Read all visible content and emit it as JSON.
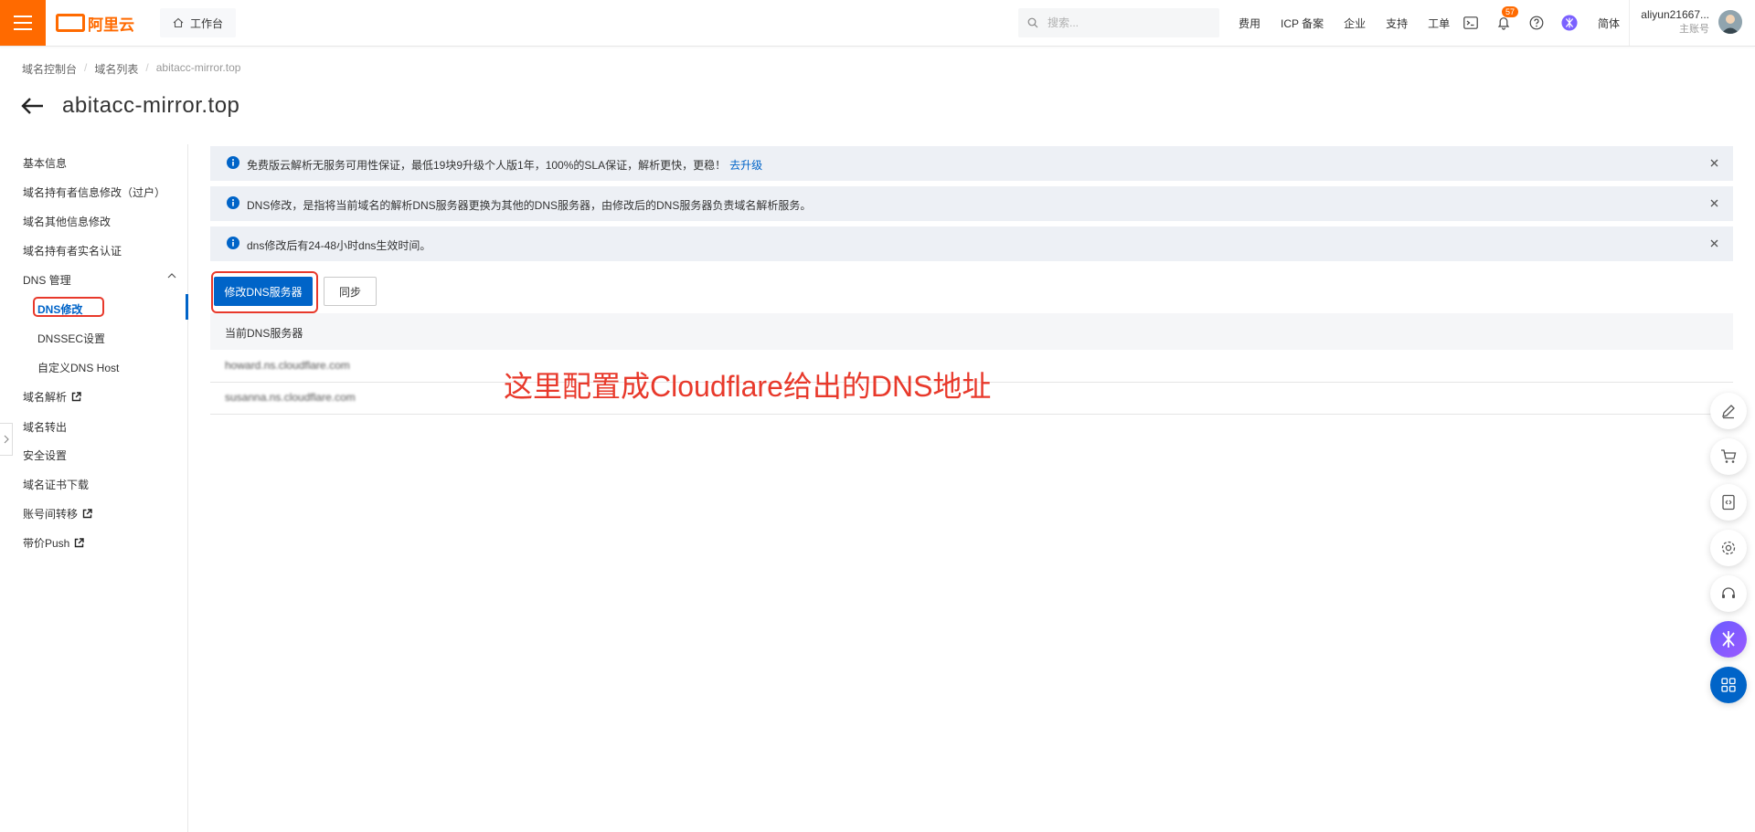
{
  "topbar": {
    "brand": "阿里云",
    "workbench_label": "工作台",
    "search_placeholder": "搜索...",
    "links": [
      "费用",
      "ICP 备案",
      "企业",
      "支持",
      "工单"
    ],
    "notification_count": "57",
    "language": "简体",
    "account_name": "aliyun21667...",
    "account_role": "主账号",
    "accent_color": "#ff6a00"
  },
  "breadcrumb": {
    "items": [
      "域名控制台",
      "域名列表"
    ],
    "current": "abitacc-mirror.top"
  },
  "page": {
    "title": "abitacc-mirror.top"
  },
  "sidebar": {
    "items": [
      {
        "label": "基本信息"
      },
      {
        "label": "域名持有者信息修改（过户）"
      },
      {
        "label": "域名其他信息修改"
      },
      {
        "label": "域名持有者实名认证"
      },
      {
        "label": "DNS 管理"
      },
      {
        "label": "DNS修改"
      },
      {
        "label": "DNSSEC设置"
      },
      {
        "label": "自定义DNS Host"
      },
      {
        "label": "域名解析"
      },
      {
        "label": "域名转出"
      },
      {
        "label": "安全设置"
      },
      {
        "label": "域名证书下载"
      },
      {
        "label": "账号间转移"
      },
      {
        "label": "带价Push"
      }
    ]
  },
  "alerts": [
    {
      "text": "免费版云解析无服务可用性保证，最低19块9升级个人版1年，100%的SLA保证，解析更快，更稳！",
      "link": "去升级"
    },
    {
      "text": "DNS修改，是指将当前域名的解析DNS服务器更换为其他的DNS服务器，由修改后的DNS服务器负责域名解析服务。"
    },
    {
      "text": "dns修改后有24-48小时dns生效时间。"
    }
  ],
  "actions": {
    "modify_dns": "修改DNS服务器",
    "sync": "同步"
  },
  "table": {
    "header": "当前DNS服务器",
    "rows": [
      "howard.ns.cloudflare.com",
      "susanna.ns.cloudflare.com"
    ]
  },
  "annotation": "这里配置成Cloudflare给出的DNS地址"
}
